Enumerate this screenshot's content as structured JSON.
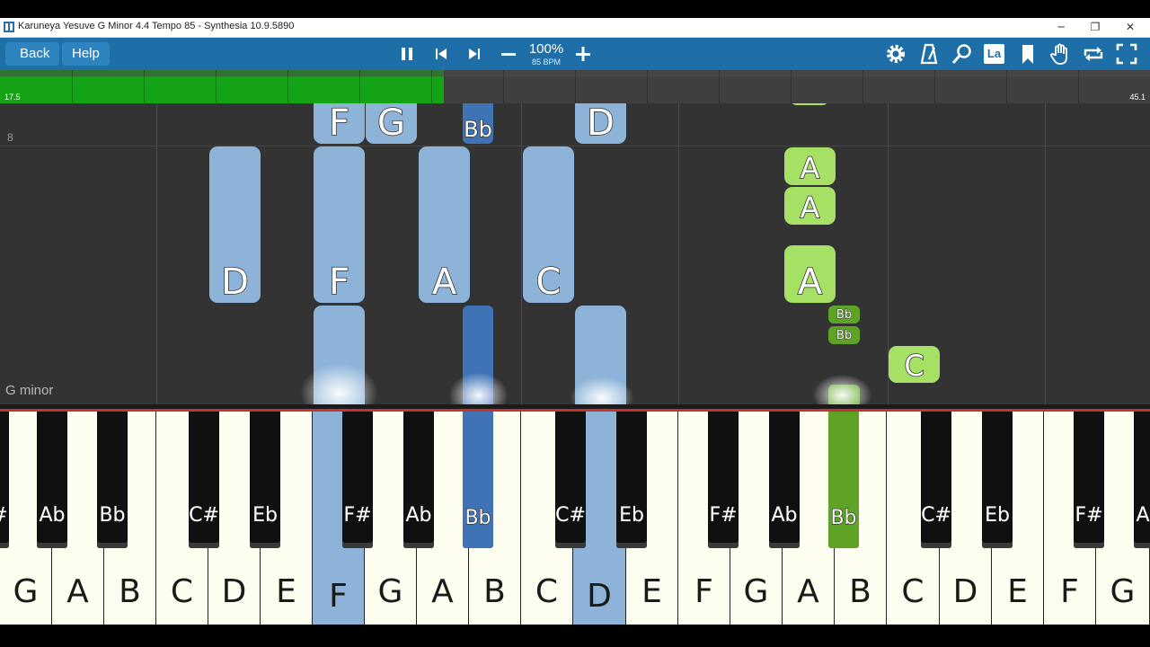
{
  "window": {
    "title": "Karuneya Yesuve G Minor 4.4 Tempo 85 - Synthesia 10.9.5890"
  },
  "toolbar": {
    "back_label": "Back",
    "help_label": "Help",
    "zoom": "100%",
    "tempo": "85 BPM",
    "la_label": "La",
    "icons": [
      "pause-icon",
      "skip-back-icon",
      "skip-forward-icon",
      "minus-icon",
      "plus-icon",
      "gear-icon",
      "metronome-icon",
      "search-icon",
      "bookmark-icon",
      "hand-icon",
      "loop-icon",
      "fullscreen-icon"
    ]
  },
  "progress": {
    "start_label": "17.5",
    "end_label": "45.1",
    "played_fraction": 0.386,
    "fill_color": "#14a314"
  },
  "roll": {
    "measure_number": "8",
    "key_signature": "G minor",
    "notes": [
      {
        "label": "F",
        "hand": "left"
      },
      {
        "label": "G",
        "hand": "left"
      },
      {
        "label": "Bb",
        "hand": "left"
      },
      {
        "label": "D",
        "hand": "left"
      },
      {
        "label": "D",
        "hand": "left"
      },
      {
        "label": "F",
        "hand": "left"
      },
      {
        "label": "A",
        "hand": "left"
      },
      {
        "label": "C",
        "hand": "left"
      },
      {
        "label": "A",
        "hand": "right"
      },
      {
        "label": "A",
        "hand": "right"
      },
      {
        "label": "A",
        "hand": "right"
      },
      {
        "label": "Bb",
        "hand": "right"
      },
      {
        "label": "Bb",
        "hand": "right"
      },
      {
        "label": "C",
        "hand": "right"
      }
    ],
    "colors": {
      "left_hand": "#8db4d8",
      "left_hand_black": "#3f73b5",
      "right_hand": "#a6e064",
      "right_hand_black": "#5ea326"
    }
  },
  "keyboard": {
    "white_keys": [
      "G",
      "A",
      "B",
      "C",
      "D",
      "E",
      "F",
      "G",
      "A",
      "B",
      "C",
      "D",
      "E",
      "F",
      "G",
      "A",
      "B",
      "C",
      "D",
      "E",
      "F",
      "G"
    ],
    "black_keys": [
      "F#",
      "Ab",
      "Bb",
      "C#",
      "Eb",
      "F#",
      "Ab",
      "Bb",
      "C#",
      "Eb",
      "F#",
      "Ab",
      "Bb",
      "C#",
      "Eb",
      "F#",
      "Ab"
    ],
    "pressed": [
      "F",
      "Bb",
      "D",
      "Bb"
    ]
  }
}
